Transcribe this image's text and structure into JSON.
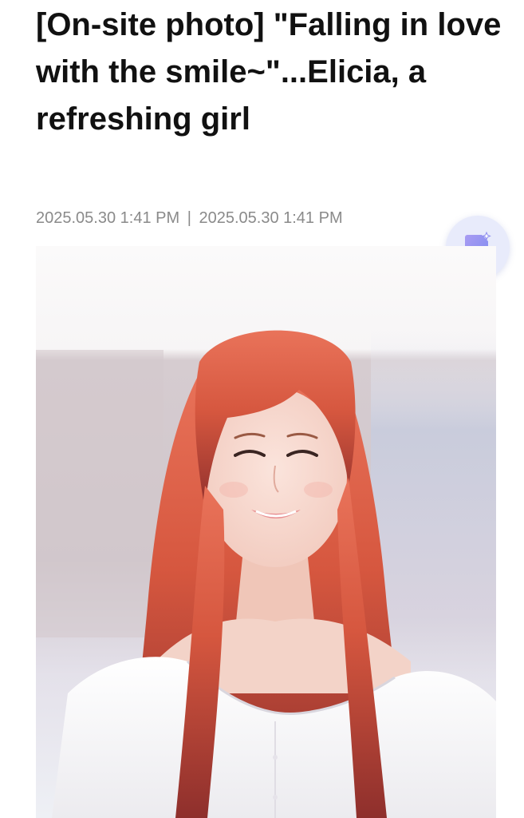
{
  "article": {
    "headline": "[On-site photo] \"Falling in love with the smile~\"...Elicia, a refreshing girl",
    "published": "2025.05.30 1:41 PM",
    "separator": "|",
    "updated": "2025.05.30 1:41 PM"
  },
  "summary_button": {
    "icon": "ai-summary-document-icon",
    "accent_color": "#8f8ef0",
    "background_color": "#e8ebfb"
  },
  "photo": {
    "subject": "photo-of-woman-with-long-orange-hair-in-white-blouse"
  },
  "colors": {
    "headline": "#111111",
    "meta": "#8a8a8a"
  }
}
